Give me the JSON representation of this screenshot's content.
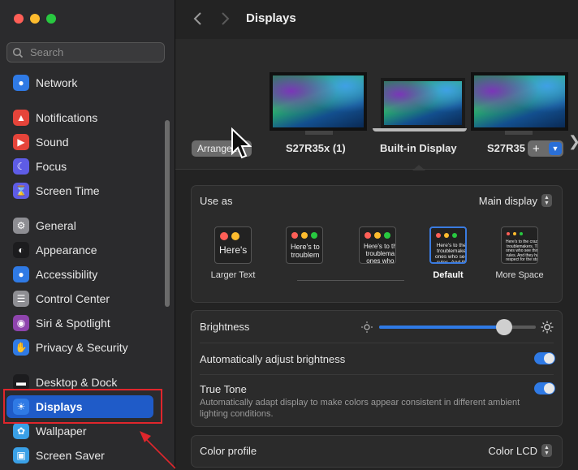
{
  "sidebar": {
    "search_placeholder": "Search",
    "items": [
      {
        "label": "Network",
        "icon": "globe-icon",
        "color": "#2f7ae5"
      },
      {
        "label": "Notifications",
        "icon": "bell-icon",
        "color": "#e5443a"
      },
      {
        "label": "Sound",
        "icon": "speaker-icon",
        "color": "#e5443a"
      },
      {
        "label": "Focus",
        "icon": "moon-icon",
        "color": "#5e5ce6"
      },
      {
        "label": "Screen Time",
        "icon": "hourglass-icon",
        "color": "#5e5ce6"
      },
      {
        "label": "General",
        "icon": "gear-icon",
        "color": "#8e8e93"
      },
      {
        "label": "Appearance",
        "icon": "appearance-icon",
        "color": "#1c1c1e"
      },
      {
        "label": "Accessibility",
        "icon": "accessibility-icon",
        "color": "#2f7ae5"
      },
      {
        "label": "Control Center",
        "icon": "control-center-icon",
        "color": "#8e8e93"
      },
      {
        "label": "Siri & Spotlight",
        "icon": "siri-icon",
        "color": "#8e44ad"
      },
      {
        "label": "Privacy & Security",
        "icon": "hand-icon",
        "color": "#2f7ae5"
      },
      {
        "label": "Desktop & Dock",
        "icon": "dock-icon",
        "color": "#1c1c1e"
      },
      {
        "label": "Displays",
        "icon": "sun-icon",
        "color": "#2f7ae5"
      },
      {
        "label": "Wallpaper",
        "icon": "wallpaper-icon",
        "color": "#3aa0e6"
      },
      {
        "label": "Screen Saver",
        "icon": "screen-saver-icon",
        "color": "#3aa0e6"
      }
    ]
  },
  "header": {
    "title": "Displays"
  },
  "arrangement": {
    "arrange_label": "Arrange...",
    "monitors": [
      {
        "label": "S27R35x (1)"
      },
      {
        "label": "Built-in Display"
      },
      {
        "label": "S27R35"
      }
    ],
    "add_label": "+"
  },
  "use_as": {
    "label": "Use as",
    "value": "Main display"
  },
  "scale_options": [
    {
      "label": "Larger Text",
      "sample": "Here's"
    },
    {
      "label": "",
      "sample": "Here's to\ntroublem"
    },
    {
      "label": "",
      "sample": "Here's to th\ntroublema\nones who"
    },
    {
      "label": "Default",
      "sample": "Here's to the cr\ntroublemakers.\nones who see th\nrules. And they"
    },
    {
      "label": "More Space",
      "sample": "Here's to the crazy ones\ntroublemakers. The rou\nones who see things diff\nrules. And they have no\nrespect for the status qu"
    }
  ],
  "brightness": {
    "label": "Brightness",
    "level": 0.8
  },
  "auto_brightness": {
    "label": "Automatically adjust brightness",
    "on": true
  },
  "true_tone": {
    "label": "True Tone",
    "on": true,
    "description": "Automatically adapt display to make colors appear consistent in different ambient lighting conditions."
  },
  "color_profile": {
    "label": "Color profile",
    "value": "Color LCD"
  }
}
